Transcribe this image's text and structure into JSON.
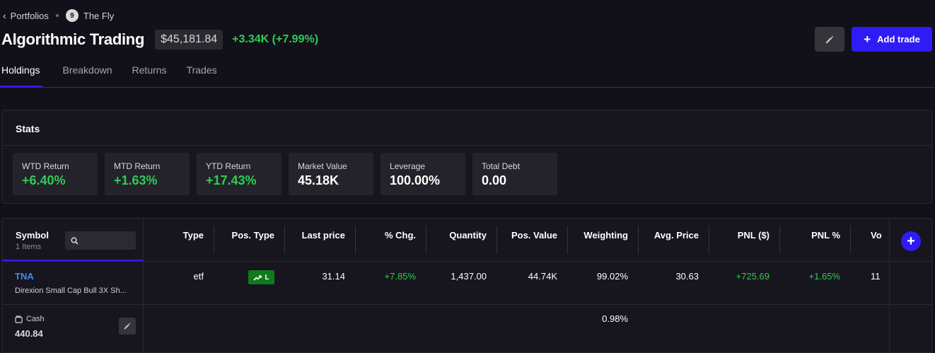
{
  "breadcrumb": {
    "back_label": "Portfolios",
    "owner_initial": "9",
    "owner_name": "The Fly"
  },
  "portfolio": {
    "title": "Algorithmic Trading",
    "value": "$45,181.84",
    "change": "+3.34K (+7.99%)"
  },
  "actions": {
    "add_trade_label": "Add trade"
  },
  "tabs": [
    {
      "label": "Holdings",
      "active": true
    },
    {
      "label": "Breakdown",
      "active": false
    },
    {
      "label": "Returns",
      "active": false
    },
    {
      "label": "Trades",
      "active": false
    }
  ],
  "stats": {
    "title": "Stats",
    "cards": [
      {
        "label": "WTD Return",
        "value": "+6.40%",
        "positive": true
      },
      {
        "label": "MTD Return",
        "value": "+1.63%",
        "positive": true
      },
      {
        "label": "YTD Return",
        "value": "+17.43%",
        "positive": true
      },
      {
        "label": "Market Value",
        "value": "45.18K",
        "positive": false
      },
      {
        "label": "Leverage",
        "value": "100.00%",
        "positive": false
      },
      {
        "label": "Total Debt",
        "value": "0.00",
        "positive": false
      }
    ]
  },
  "table": {
    "symbol_header": "Symbol",
    "item_count": "1 Items",
    "columns": [
      "Type",
      "Pos. Type",
      "Last price",
      "% Chg.",
      "Quantity",
      "Pos. Value",
      "Weighting",
      "Avg. Price",
      "PNL ($)",
      "PNL %",
      "Vo"
    ],
    "rows": [
      {
        "symbol": "TNA",
        "name": "Direxion Small Cap Bull 3X Sh...",
        "type": "etf",
        "pos_type": "L",
        "last_price": "31.14",
        "pct_chg": "+7.85%",
        "quantity": "1,437.00",
        "pos_value": "44.74K",
        "weighting": "99.02%",
        "avg_price": "30.63",
        "pnl": "+725.69",
        "pnl_pct": "+1.65%",
        "vol": "11"
      }
    ],
    "cash": {
      "label": "Cash",
      "value": "440.84",
      "weighting": "0.98%"
    }
  },
  "colors": {
    "accent": "#2f1cf5",
    "positive": "#2ecc55",
    "link": "#3d8bff",
    "background": "#121018"
  }
}
